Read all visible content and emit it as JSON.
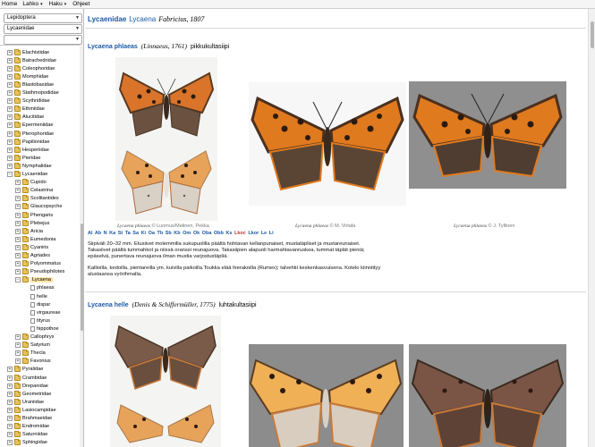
{
  "menu": [
    {
      "label": "Home"
    },
    {
      "label": "Lahko"
    },
    {
      "label": "Haku"
    },
    {
      "label": "Ohjeet"
    }
  ],
  "sidebar": {
    "select_order": "Lepidoptera",
    "select_family": "Lycaenidae",
    "select_third": "",
    "tree": [
      {
        "label": "Elachistidae",
        "level": 0,
        "exp": "+",
        "type": "folder"
      },
      {
        "label": "Batrachedridae",
        "level": 0,
        "exp": "+",
        "type": "folder"
      },
      {
        "label": "Coleophoridae",
        "level": 0,
        "exp": "+",
        "type": "folder"
      },
      {
        "label": "Momphidae",
        "level": 0,
        "exp": "+",
        "type": "folder"
      },
      {
        "label": "Blastobasidae",
        "level": 0,
        "exp": "+",
        "type": "folder"
      },
      {
        "label": "Stathmopodidae",
        "level": 0,
        "exp": "+",
        "type": "folder"
      },
      {
        "label": "Scythrididae",
        "level": 0,
        "exp": "+",
        "type": "folder"
      },
      {
        "label": "Ethmiidae",
        "level": 0,
        "exp": "+",
        "type": "folder"
      },
      {
        "label": "Alucitidae",
        "level": 0,
        "exp": "+",
        "type": "folder"
      },
      {
        "label": "Epermeniidae",
        "level": 0,
        "exp": "+",
        "type": "folder"
      },
      {
        "label": "Pterophoridae",
        "level": 0,
        "exp": "+",
        "type": "folder"
      },
      {
        "label": "Papilionidae",
        "level": 0,
        "exp": "+",
        "type": "folder"
      },
      {
        "label": "Hesperiidae",
        "level": 0,
        "exp": "+",
        "type": "folder"
      },
      {
        "label": "Pieridae",
        "level": 0,
        "exp": "+",
        "type": "folder"
      },
      {
        "label": "Nymphalidae",
        "level": 0,
        "exp": "+",
        "type": "folder"
      },
      {
        "label": "Lycaenidae",
        "level": 0,
        "exp": "−",
        "type": "folder"
      },
      {
        "label": "Cupido",
        "level": 1,
        "exp": "+",
        "type": "folder"
      },
      {
        "label": "Celastrina",
        "level": 1,
        "exp": "+",
        "type": "folder"
      },
      {
        "label": "Scolitantides",
        "level": 1,
        "exp": "+",
        "type": "folder"
      },
      {
        "label": "Glaucopsyche",
        "level": 1,
        "exp": "+",
        "type": "folder"
      },
      {
        "label": "Phengaris",
        "level": 1,
        "exp": "+",
        "type": "folder"
      },
      {
        "label": "Plebejus",
        "level": 1,
        "exp": "+",
        "type": "folder"
      },
      {
        "label": "Aricia",
        "level": 1,
        "exp": "+",
        "type": "folder"
      },
      {
        "label": "Eumedonia",
        "level": 1,
        "exp": "+",
        "type": "folder"
      },
      {
        "label": "Cyaniris",
        "level": 1,
        "exp": "+",
        "type": "folder"
      },
      {
        "label": "Agriades",
        "level": 1,
        "exp": "+",
        "type": "folder"
      },
      {
        "label": "Polyommatus",
        "level": 1,
        "exp": "+",
        "type": "folder"
      },
      {
        "label": "Pseudophilotes",
        "level": 1,
        "exp": "+",
        "type": "folder"
      },
      {
        "label": "Lycaena",
        "level": 1,
        "exp": "−",
        "type": "folder",
        "selected": true
      },
      {
        "label": "phlaeas",
        "level": 2,
        "exp": "",
        "type": "page"
      },
      {
        "label": "helle",
        "level": 2,
        "exp": "",
        "type": "page"
      },
      {
        "label": "dispar",
        "level": 2,
        "exp": "",
        "type": "page"
      },
      {
        "label": "virgaureae",
        "level": 2,
        "exp": "",
        "type": "page"
      },
      {
        "label": "tityrus",
        "level": 2,
        "exp": "",
        "type": "page"
      },
      {
        "label": "hippothoe",
        "level": 2,
        "exp": "",
        "type": "page"
      },
      {
        "label": "Callophrys",
        "level": 1,
        "exp": "+",
        "type": "folder"
      },
      {
        "label": "Satyrium",
        "level": 1,
        "exp": "+",
        "type": "folder"
      },
      {
        "label": "Thecla",
        "level": 1,
        "exp": "+",
        "type": "folder"
      },
      {
        "label": "Favonius",
        "level": 1,
        "exp": "+",
        "type": "folder"
      },
      {
        "label": "Pyralidae",
        "level": 0,
        "exp": "+",
        "type": "folder"
      },
      {
        "label": "Crambidae",
        "level": 0,
        "exp": "+",
        "type": "folder"
      },
      {
        "label": "Drepanidae",
        "level": 0,
        "exp": "+",
        "type": "folder"
      },
      {
        "label": "Geometridae",
        "level": 0,
        "exp": "+",
        "type": "folder"
      },
      {
        "label": "Uraniidae",
        "level": 0,
        "exp": "+",
        "type": "folder"
      },
      {
        "label": "Lasiocampidae",
        "level": 0,
        "exp": "+",
        "type": "folder"
      },
      {
        "label": "Brahmaeidae",
        "level": 0,
        "exp": "+",
        "type": "folder"
      },
      {
        "label": "Endromidae",
        "level": 0,
        "exp": "+",
        "type": "folder"
      },
      {
        "label": "Saturniidae",
        "level": 0,
        "exp": "+",
        "type": "folder"
      },
      {
        "label": "Sphingidae",
        "level": 0,
        "exp": "+",
        "type": "folder"
      }
    ]
  },
  "main": {
    "family": {
      "name": "Lycaenidae",
      "genus": "Lycaena",
      "author": "Fabricius, 1807"
    },
    "species1": {
      "name": "Lycaena phlaeas",
      "author": "(Linnaeus, 1761)",
      "common": "pikkukultasiipi",
      "captions": [
        {
          "sp": "Lycaena phlaeas",
          "credit": "© Luomus/Malinen, Pekka"
        },
        {
          "sp": "Lycaena phlaeas",
          "credit": "© M. Virtala"
        },
        {
          "sp": "Lycaena phlaeas",
          "credit": "© J. Tyllinen"
        }
      ],
      "regions_text": "Al Ab N Ka St Ta Sa Ki Oa Tb Sb Kb Om Ok Oba Obb Ks",
      "regions_red": "Lkoc",
      "regions_tail": "Lkor Le Li",
      "desc1": "Siipiväli 20–32 mm. Etusiivet molemmilla sukupuolilla päältä hohtavan kellanpunaiset, mustatäpliset ja mustareunaiset. Takasiivet päältä tummahkot ja niissä oranssi reunajuova. Takasiipien alapuoli harmahtavanruskea, tummat täplät pieniä; epäselvä, punertava reunajuova ilman mustia varjostustäpliä.",
      "desc2": "Kallioilla, kedoilla, pientareilla ym. kuivilla paikoilla.Toukka elää hierakoilla (Rumex); talvehtii keskenkasvuisena. Kotelo kiinnittyy alustaansa vyörihmalla."
    },
    "species2": {
      "name": "Lycaena helle",
      "author": "(Denis & Schiffermüller, 1775)",
      "common": "luhtakultasiipi"
    }
  },
  "colors": {
    "link": "#1a5aa6",
    "wing_orange": "#e07a1f",
    "wing_brown": "#5a4535",
    "selected_bg": "#fbe6a8"
  }
}
